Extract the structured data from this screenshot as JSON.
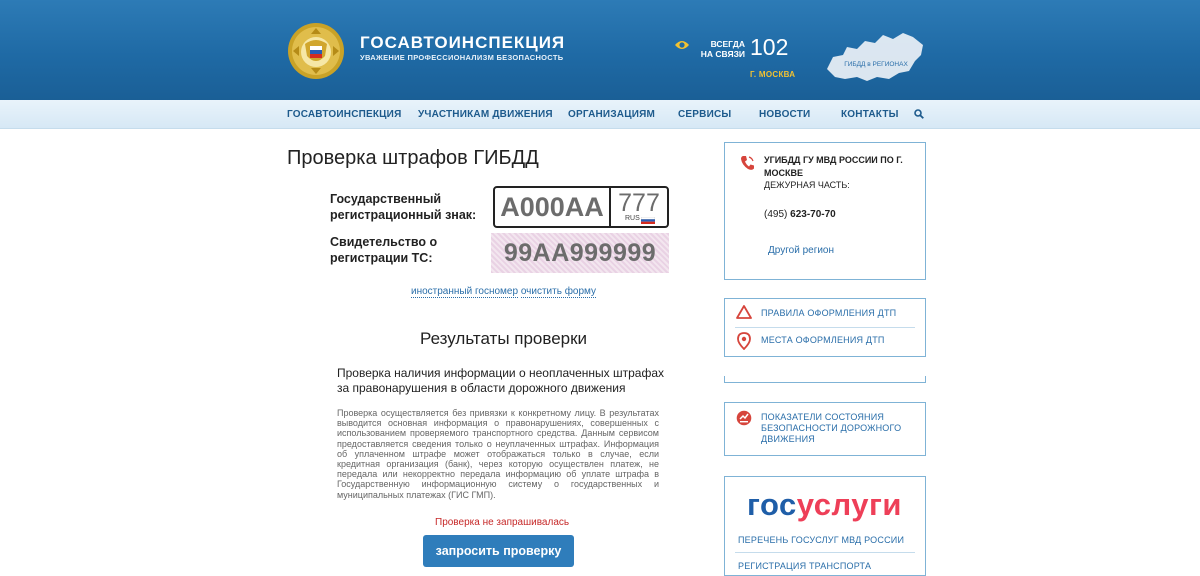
{
  "header": {
    "brand_title": "ГОСАВТОИНСПЕКЦИЯ",
    "brand_subtitle": "УВАЖЕНИЕ ПРОФЕССИОНАЛИЗМ БЕЗОПАСНОСТЬ",
    "always_line1": "ВСЕГДА",
    "always_line2": "НА СВЯЗИ",
    "phone": "102",
    "city": "Г. МОСКВА",
    "map_label": "ГИБДД в РЕГИОНАХ"
  },
  "nav": {
    "items": [
      "ГОСАВТОИНСПЕКЦИЯ",
      "УЧАСТНИКАМ ДВИЖЕНИЯ",
      "ОРГАНИЗАЦИЯМ",
      "СЕРВИСЫ",
      "НОВОСТИ",
      "КОНТАКТЫ"
    ]
  },
  "main": {
    "title": "Проверка штрафов ГИБДД",
    "plate_label_1": "Государственный",
    "plate_label_2": "регистрационный знак:",
    "plate_number": "А000АА",
    "plate_region": "777",
    "plate_rus": "RUS",
    "cert_label_1": "Свидетельство о",
    "cert_label_2": "регистрации ТС:",
    "cert_placeholder": "99АА999999",
    "foreign_link": "иностранный госномер",
    "clear_link": "очистить форму",
    "results_title": "Результаты проверки",
    "desc_head": "Проверка наличия информации о неоплаченных штрафах за правонарушения в области дорожного движения",
    "desc_body": "Проверка осуществляется без привязки к конкретному лицу. В результатах выводится основная информация о правонарушениях, совершенных с использованием проверяемого транспортного средства. Данным сервисом предоставляется сведения только о неуплаченных штрафах. Информация об уплаченном штрафе может отображаться только в случае, если кредитная организация (банк), через которую осуществлен платеж, не передала или некорректно передала информацию об уплате штрафа в Государственную информационную систему о государственных и муниципальных платежах (ГИС ГМП).",
    "status": "Проверка не запрашивалась",
    "button": "запросить проверку"
  },
  "sidebar": {
    "org_name": "УГИБДД ГУ МВД РОССИИ ПО Г. МОСКВЕ",
    "duty_label": "ДЕЖУРНАЯ ЧАСТЬ:",
    "duty_code": "(495)",
    "duty_number": "623-70-70",
    "other_region": "Другой регион",
    "link_rules": "ПРАВИЛА ОФОРМЛЕНИЯ ДТП",
    "link_places": "МЕСТА ОФОРМЛЕНИЯ ДТП",
    "stats": "ПОКАЗАТЕЛИ СОСТОЯНИЯ БЕЗОПАСНОСТИ ДОРОЖНОГО ДВИЖЕНИЯ",
    "gos_part1": "гос",
    "gos_part2": "услуги",
    "gos_link1": "ПЕРЕЧЕНЬ ГОСУСЛУГ МВД РОССИИ",
    "gos_link2": "РЕГИСТРАЦИЯ ТРАНСПОРТА"
  },
  "icons": [
    "emblem-icon",
    "eye-icon",
    "russia-map-icon",
    "search-icon",
    "phone-icon",
    "warning-triangle-icon",
    "map-pin-icon",
    "stats-icon"
  ],
  "colors": {
    "header_blue": "#1f6aa5",
    "nav_text": "#1d5a8c",
    "link": "#2a6ea9",
    "accent_yellow": "#f1c232",
    "status_red": "#c62828",
    "button": "#2f7dbb",
    "gos_blue": "#1f5ea8",
    "gos_red": "#ee3f58"
  }
}
